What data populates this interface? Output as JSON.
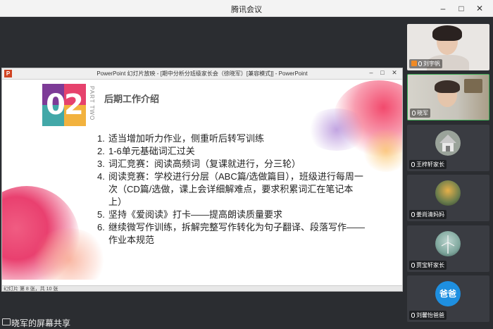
{
  "window": {
    "title": "腾讯会议"
  },
  "ppt_window": {
    "title": "PowerPoint 幻灯片放映 - [期中分析分班级家长会（徐晓军）[兼容模式]] - PowerPoint",
    "status": "幻灯片 第 8 张，共 10 张"
  },
  "slide": {
    "number_badge": "02",
    "part_label": "PART TWO",
    "heading": "后期工作介绍",
    "items": [
      {
        "n": "1.",
        "text": "适当增加听力作业，侧重听后转写训练"
      },
      {
        "n": "2.",
        "text": "1-6单元基础词汇过关"
      },
      {
        "n": "3.",
        "text": "词汇竞赛：阅读高频词（复课就进行，分三轮）"
      },
      {
        "n": "4.",
        "text": "阅读竞赛：学校进行分层（ABC篇/选做篇目），班级进行每周一次（CD篇/选做，课上会详细解难点，要求积累词汇在笔记本上）"
      },
      {
        "n": "5.",
        "text": "坚持《爱阅读》打卡——提高朗读质量要求"
      },
      {
        "n": "6.",
        "text": "继续微写作训练，拆解完整写作转化为句子翻译、段落写作——作业本规范"
      }
    ]
  },
  "share_bar": {
    "text": "晓军的屏幕共享"
  },
  "participants": [
    {
      "name": "刘宇帆",
      "kind": "video",
      "host": true
    },
    {
      "name": "晓军",
      "kind": "video",
      "host": false
    },
    {
      "name": "王梓轩家长",
      "kind": "avatar",
      "avatar": "house-icon"
    },
    {
      "name": "姜尚清妈妈",
      "kind": "avatar",
      "avatar": "tree-icon"
    },
    {
      "name": "贾宝轩家长",
      "kind": "avatar",
      "avatar": "turbine-icon"
    },
    {
      "name": "刘馨怡爸爸",
      "kind": "avatar",
      "avatar_text": "爸爸"
    }
  ],
  "colors": {
    "accent_green": "#3fae57",
    "ppt_red": "#d04423",
    "avatar_blue": "#1e8fe0"
  }
}
